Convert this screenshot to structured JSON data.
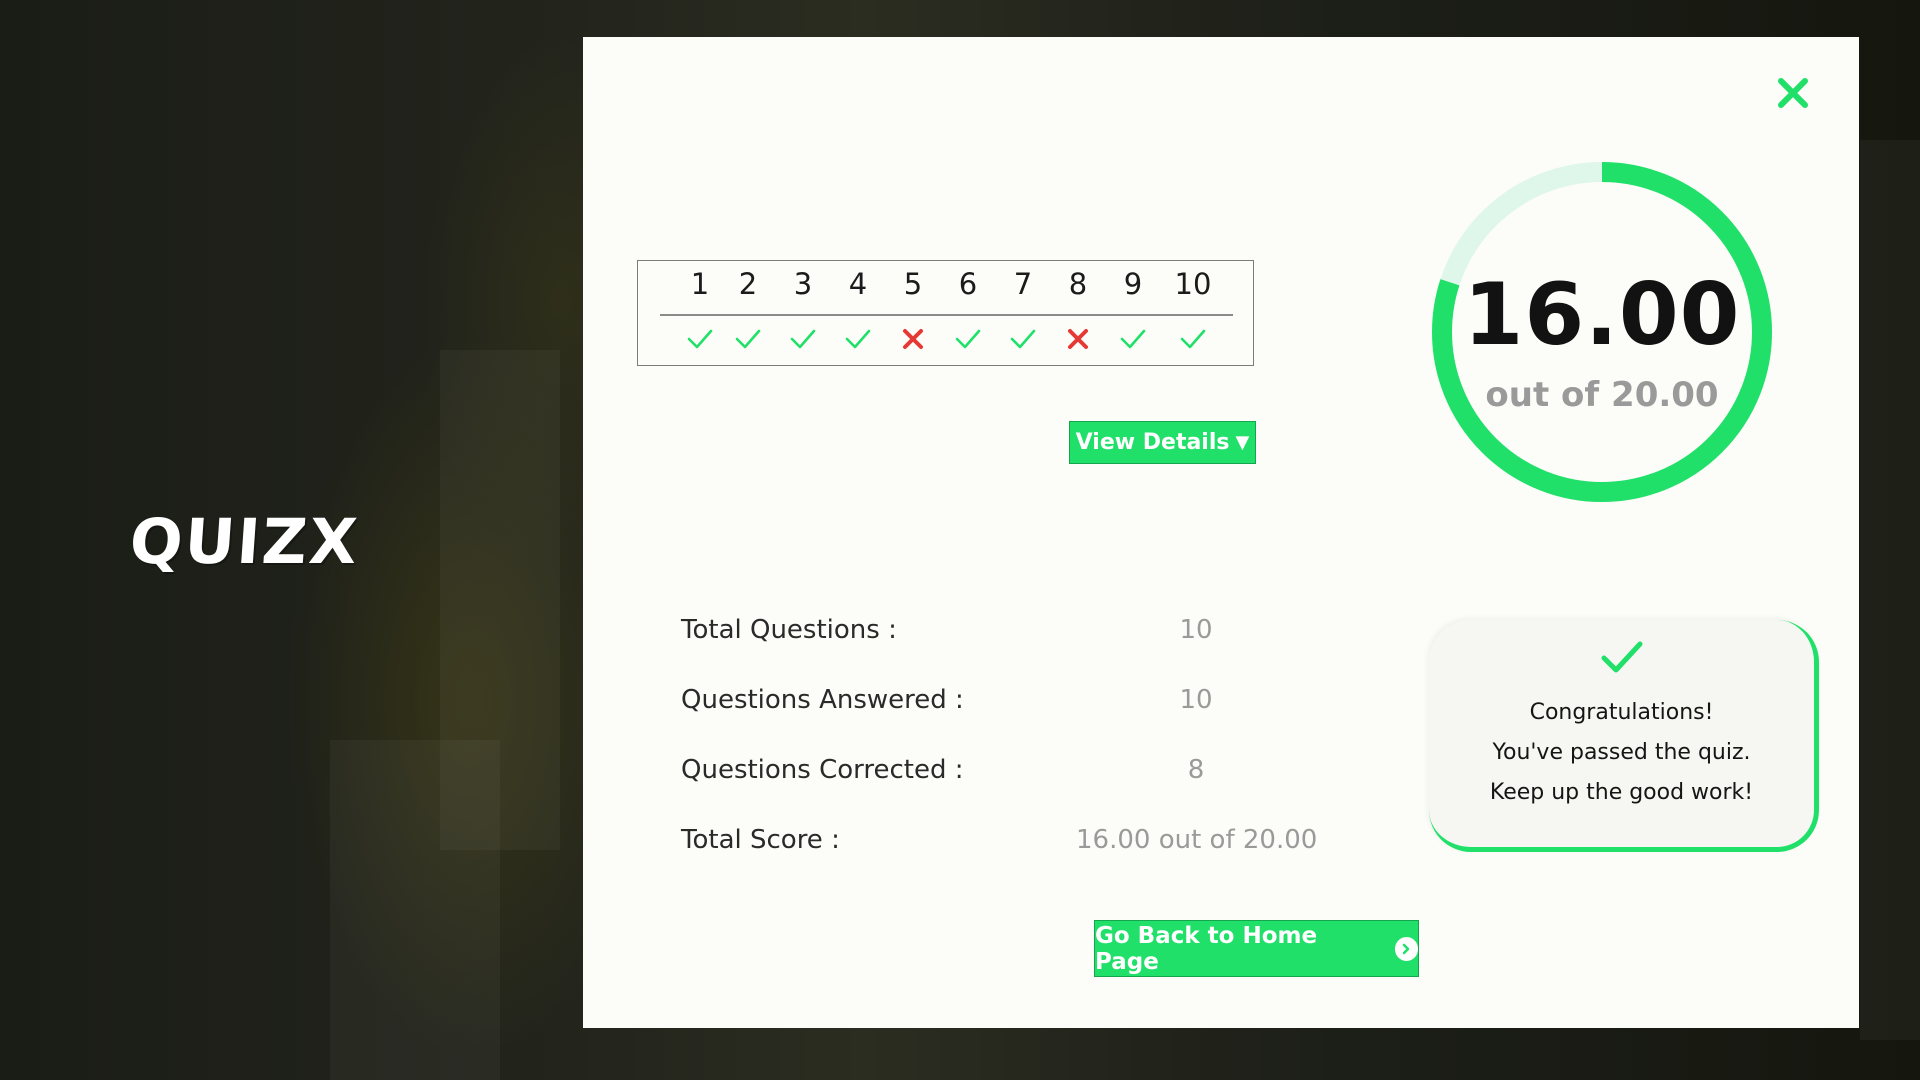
{
  "app": {
    "logo_text": "QUIZX"
  },
  "colors": {
    "accent": "#20e06a",
    "wrong": "#e53935",
    "ring_track": "#dff7ea"
  },
  "icons": {
    "close": "close-icon",
    "correct": "check-icon",
    "wrong": "cross-icon",
    "next": "chevron-right-circle-icon",
    "dropdown": "triangle-down-icon"
  },
  "answers": {
    "questions": [
      {
        "number": "1",
        "result": "correct"
      },
      {
        "number": "2",
        "result": "correct"
      },
      {
        "number": "3",
        "result": "correct"
      },
      {
        "number": "4",
        "result": "correct"
      },
      {
        "number": "5",
        "result": "wrong"
      },
      {
        "number": "6",
        "result": "correct"
      },
      {
        "number": "7",
        "result": "correct"
      },
      {
        "number": "8",
        "result": "wrong"
      },
      {
        "number": "9",
        "result": "correct"
      },
      {
        "number": "10",
        "result": "correct"
      }
    ]
  },
  "details_button": {
    "label": "View Details",
    "arrow": "▼"
  },
  "score": {
    "value": "16.00",
    "total_text": "out of 20.00",
    "fraction": 0.8
  },
  "stats": {
    "total_questions_label": "Total Questions :",
    "total_questions_value": "10",
    "answered_label": "Questions Answered :",
    "answered_value": "10",
    "corrected_label": "Questions Corrected :",
    "corrected_value": "8",
    "total_score_label": "Total Score :",
    "total_score_value": "16.00 out of 20.00"
  },
  "congrats": {
    "line1": "Congratulations!",
    "line2": "You've passed the quiz.",
    "line3": "Keep up the good work!"
  },
  "home_button": {
    "label": "Go Back to Home Page"
  }
}
